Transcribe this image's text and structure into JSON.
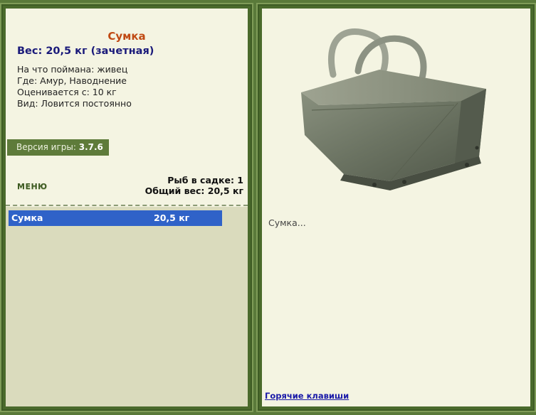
{
  "fish": {
    "title": "Сумка",
    "weight_line": "Вес: 20,5 кг (зачетная)",
    "caught_on": "На что поймана: живец",
    "where": "Где: Амур, Наводнение",
    "valued_from": "Оценивается с: 10 кг",
    "kind": "Вид: Ловится постоянно",
    "description": "Сумка..."
  },
  "version": {
    "label": "Версия игры:",
    "value": "3.7.6"
  },
  "menu": {
    "label": "МЕНЮ"
  },
  "cage": {
    "count_line": "Рыб в садке: 1",
    "total_line": "Общий вес: 20,5 кг"
  },
  "catch_list": [
    {
      "name": "Сумка",
      "weight": "20,5 кг"
    }
  ],
  "footer": {
    "hotkeys": "Горячие клавиши"
  },
  "colors": {
    "frame": "#5a7a3a",
    "panel_bg": "#f4f4e2",
    "list_bg": "#dadbbd",
    "selected_row": "#2f62c8",
    "title": "#c04a14",
    "weight": "#1a1a7a"
  },
  "icons": {
    "fish_image": "bag-image"
  }
}
